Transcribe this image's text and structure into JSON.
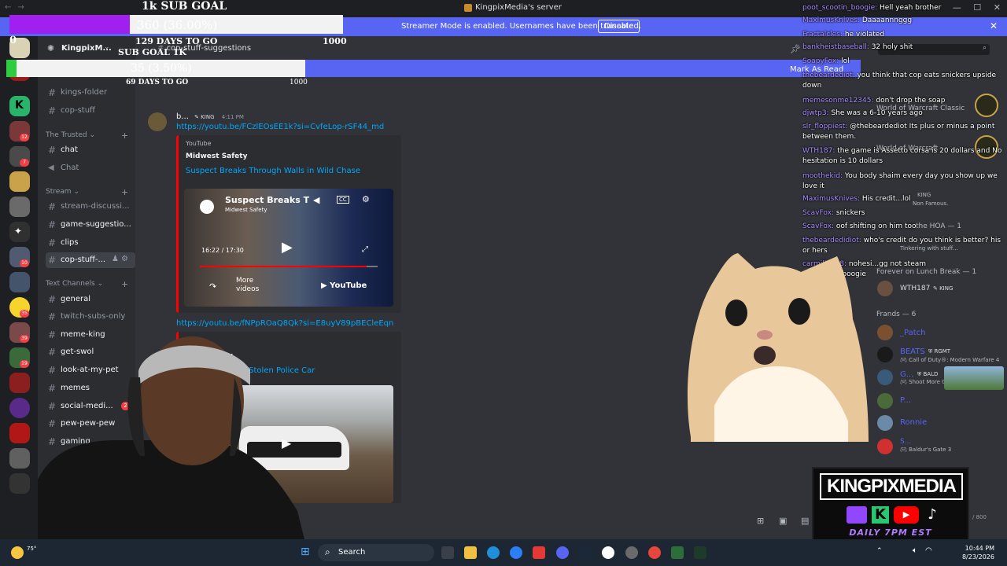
{
  "window": {
    "title": "KingpixMedia's server",
    "controls": [
      "—",
      "☐",
      "✕"
    ]
  },
  "banner": {
    "message": "Streamer Mode is enabled. Usernames have been truncated.",
    "button": "Disable"
  },
  "goal_top": {
    "title": "1k SUB GOAL",
    "progress_label": "360 (36.00%)",
    "progress_fraction": 0.36,
    "start": "0",
    "end": "1000",
    "days": "129 DAYS TO GO"
  },
  "goal_bottom": {
    "title": "SUB GOAL 1K",
    "progress_label": "35 (3.50%)",
    "progress_fraction": 0.035,
    "start": "0",
    "end": "1000",
    "days": "69 DAYS TO GO"
  },
  "server": {
    "name": "KingpixM...",
    "topic_channel": "cop-stuff-suggestions",
    "mark_as_read": "Mark As Read"
  },
  "sidebar": {
    "channels_top": [
      {
        "label": "kings-folder",
        "unread": false
      },
      {
        "label": "cop-stuff",
        "unread": false
      }
    ],
    "cat_trusted": "The Trusted",
    "trusted": [
      {
        "label": "chat",
        "unread": true
      },
      {
        "label": "Chat",
        "unread": false,
        "voice": true
      }
    ],
    "cat_stream": "Stream",
    "stream": [
      {
        "label": "stream-discussi...",
        "unread": false
      },
      {
        "label": "game-suggestio...",
        "unread": true
      },
      {
        "label": "clips",
        "unread": true
      },
      {
        "label": "cop-stuff-...",
        "selected": true
      }
    ],
    "cat_text": "Text Channels",
    "text": [
      {
        "label": "general",
        "unread": true
      },
      {
        "label": "twitch-subs-only",
        "unread": false
      },
      {
        "label": "meme-king",
        "unread": true
      },
      {
        "label": "get-swol",
        "unread": true
      },
      {
        "label": "look-at-my-pet",
        "unread": true
      },
      {
        "label": "memes",
        "unread": true
      },
      {
        "label": "social-medi...",
        "unread": true,
        "badge": "2"
      },
      {
        "label": "pew-pew-pew",
        "unread": true
      },
      {
        "label": "gaming",
        "unread": true
      }
    ]
  },
  "message": {
    "author": "b...",
    "role": "KING",
    "time": "4:11 PM",
    "link1": "https://youtu.be/FCzlEOsEE1k?si=CvfeLop-rSF44_md",
    "embed1": {
      "provider": "YouTube",
      "author": "Midwest Safety",
      "title": "Suspect Breaks Through Walls in Wild Chase",
      "video_title": "Suspect Breaks T",
      "channel": "Midwest Safety",
      "time": "16:22 / 17:30",
      "more": "More videos",
      "yt": "YouTube"
    },
    "link2": "https://youtu.be/fNPpROaQ8Qk?si=E8uyV89pBECleEqn",
    "embed2": {
      "author_partial": "y",
      "title_partial": "e of Stolen Police Car"
    },
    "char_count": "/ 800"
  },
  "stream_chat": [
    {
      "user": "poot_scootin_boogie:",
      "text": "Hell yeah brother"
    },
    {
      "user": "MaximusKnives:",
      "text": "Daaaannnggg"
    },
    {
      "user": "Fractalcles:",
      "text": "he violated"
    },
    {
      "user": "bankheistbaseball:",
      "text": "32 holy shit"
    },
    {
      "user": "SoapyFox:",
      "text": "lol"
    },
    {
      "user": "thebeardediot:",
      "text": "you think that cop eats snickers upside down"
    },
    {
      "user": "memesonme12345:",
      "text": "don't drop the soap"
    },
    {
      "user": "djwtp3:",
      "text": "She was a 6-10 years ago"
    },
    {
      "user": "slr_floppiest:",
      "text": "@thebeardediot Its plus or minus a point between them."
    },
    {
      "user": "WTH187:",
      "text": "the game is Assetto corsa is 20 dollars and No hesitation is 10 dollars"
    },
    {
      "user": "moothekid:",
      "text": "You body shaim every day you show up we love it"
    },
    {
      "user": "MaximusKnives:",
      "text": "His credit...lol"
    },
    {
      "user": "ScavFox:",
      "text": "snickers"
    },
    {
      "user": "ScavFox:",
      "text": "oof shifting on him too"
    },
    {
      "user": "thebeardedidiot:",
      "text": "who's credit do you think is better? his or hers"
    },
    {
      "user": "carmilla208:",
      "text": "nohesi...gg not steam"
    },
    {
      "user": "",
      "text": "ot_scootin_boogie"
    }
  ],
  "members": {
    "wow1": "World of Warcraft Classic",
    "wow2": "World of Warcraft",
    "king": "KING",
    "non_famous": "Non Famous.",
    "hoa": "the HOA — 1",
    "tinkering": "Tinkering with stuff...",
    "lunch": "Forever on Lunch Break — 1",
    "wth": "WTH187",
    "wth_role": "KING",
    "frands": "Frands — 6",
    "patch": "_Patch",
    "beats": "BEATS",
    "beats_role": "RGMT",
    "beats_game": "Call of Duty®: Modern Warfare 4",
    "g": "G...",
    "g_role": "BALD",
    "g_game": "Shoot More Guns",
    "p": "P...",
    "ronnie": "Ronnie",
    "s": "S...",
    "s_game": "Baldur's Gate 3"
  },
  "logo": {
    "name": "KINGPIXMEDIA",
    "tagline": "DAILY 7PM EST"
  },
  "taskbar": {
    "search": "Search",
    "time": "10:44 PM",
    "date": "8/23/2026",
    "weather": "75°"
  }
}
